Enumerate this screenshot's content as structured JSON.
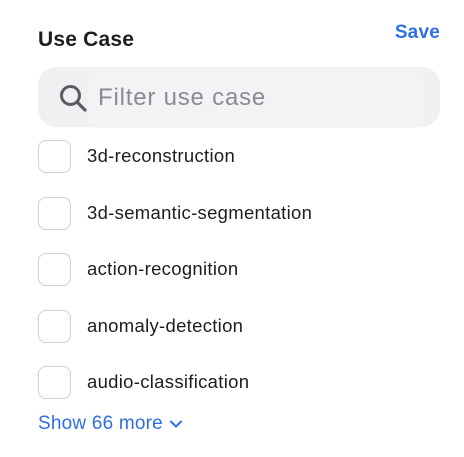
{
  "header": {
    "title": "Use Case",
    "save_label": "Save"
  },
  "search": {
    "placeholder": "Filter use case",
    "value": "",
    "icon": "search-icon"
  },
  "options": [
    {
      "label": "3d-reconstruction",
      "checked": false
    },
    {
      "label": "3d-semantic-segmentation",
      "checked": false
    },
    {
      "label": "action-recognition",
      "checked": false
    },
    {
      "label": "anomaly-detection",
      "checked": false
    },
    {
      "label": "audio-classification",
      "checked": false
    }
  ],
  "show_more": {
    "label": "Show 66 more",
    "icon": "chevron-down-icon"
  },
  "colors": {
    "accent": "#2f6fe0",
    "text": "#1d1d1f",
    "search_bg": "#f0f0f3",
    "checkbox_border": "#cfcfd4"
  }
}
